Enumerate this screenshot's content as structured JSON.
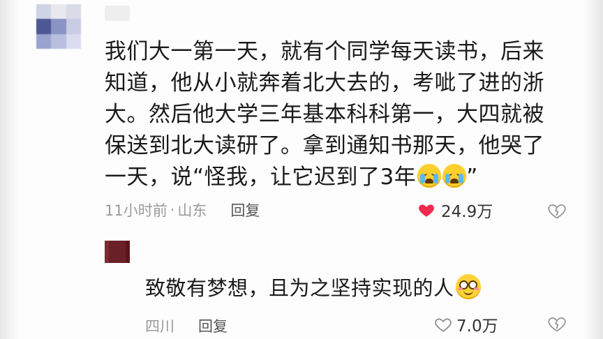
{
  "comment1": {
    "lines": [
      "我们大一第一天，就有个同学每天读书，后来",
      "知道，他从小就奔着北大去的，考呲了进的浙",
      "大。然后他大学三年基本科科第一，大四就被",
      "保送到北大读研了。拿到通知书那天，他哭了",
      "一天，说“怪我，让它迟到了3年"
    ],
    "closing_quote": "”",
    "emojis": [
      "crying-face-icon",
      "crying-face-icon"
    ],
    "time": "11小时前",
    "separator": "·",
    "location": "山东",
    "reply_label": "回复",
    "like_count": "24.9万",
    "liked": true
  },
  "comment2": {
    "text": "致敬有梦想，且为之坚持实现的人",
    "emoji": "smiling-face-icon",
    "location": "四川",
    "reply_label": "回复",
    "like_count": "7.0万",
    "liked": false
  },
  "colors": {
    "heart_red": "#f0294d",
    "text_primary": "#1a1a1a",
    "text_secondary": "#9a9a9a",
    "avatar2": "#6b1f26"
  }
}
